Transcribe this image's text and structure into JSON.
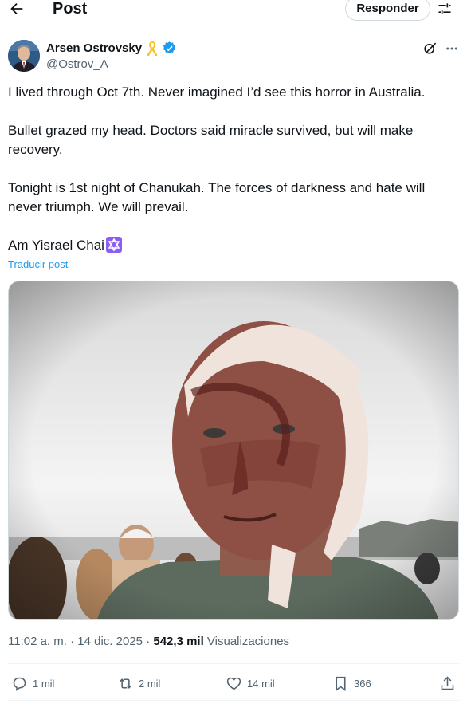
{
  "header": {
    "title": "Post",
    "reply_label": "Responder"
  },
  "author": {
    "name": "Arsen Ostrovsky",
    "handle": "@Ostrov_A"
  },
  "tweet": {
    "paragraphs": [
      "I lived through Oct 7th. Never imagined I’d see this horror in Australia.",
      "Bullet grazed my head. Doctors said miracle survived, but will make recovery.",
      "Tonight is 1st night of Chanukah. The forces of darkness and hate will never triumph. We will prevail.",
      "Am Yisrael Chai"
    ],
    "translate_label": "Traducir post"
  },
  "meta": {
    "time": "11:02 a. m.",
    "separator": "·",
    "date": "14 dic. 2025",
    "views_count": "542,3 mil",
    "views_label": "Visualizaciones"
  },
  "actions": {
    "replies": "1 mil",
    "reposts": "2 mil",
    "likes": "14 mil",
    "bookmarks": "366"
  },
  "colors": {
    "accent": "#1d9bf0",
    "text": "#0f1419",
    "muted": "#536471",
    "border": "#cfd9de",
    "ribbon": "#f4c430",
    "star_of_david_bg": "#8b5cf6"
  },
  "icons": {
    "back": "back-arrow-icon",
    "filter": "sliders-icon",
    "verified": "verified-badge-icon",
    "ribbon": "yellow-ribbon-icon",
    "grok": "grok-icon",
    "more": "more-dots-icon",
    "star": "star-of-david-icon",
    "reply": "reply-icon",
    "repost": "repost-icon",
    "like": "heart-icon",
    "bookmark": "bookmark-icon",
    "share": "share-icon"
  }
}
